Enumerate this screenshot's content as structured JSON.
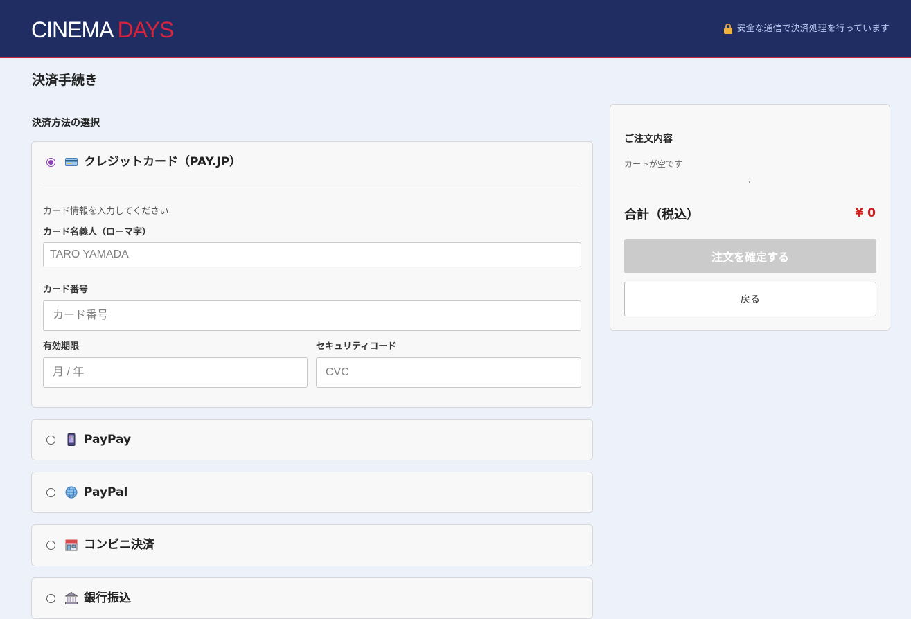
{
  "header": {
    "logo_main": "CINEMA",
    "logo_accent": "DAYS",
    "secure_text": "安全な通信で決済処理を行っています",
    "secure_icon": "lock-icon"
  },
  "page": {
    "title": "決済手続き",
    "section_label": "決済方法の選択"
  },
  "payment_methods": [
    {
      "label": "クレジットカード（PAY.JP）",
      "icon": "credit-card-icon",
      "selected": true
    },
    {
      "label": "PayPay",
      "icon": "phone-icon",
      "selected": false
    },
    {
      "label": "PayPal",
      "icon": "globe-icon",
      "selected": false
    },
    {
      "label": "コンビニ決済",
      "icon": "store-icon",
      "selected": false
    },
    {
      "label": "銀行振込",
      "icon": "bank-icon",
      "selected": false
    }
  ],
  "card_form": {
    "note": "カード情報を入力してください",
    "name_label": "カード名義人（ローマ字）",
    "name_placeholder": "TARO YAMADA",
    "number_label": "カード番号",
    "number_placeholder": "カード番号",
    "expiry_label": "有効期限",
    "expiry_placeholder": "月 / 年",
    "cvc_label": "セキュリティコード",
    "cvc_placeholder": "CVC"
  },
  "summary": {
    "title": "ご注文内容",
    "empty_text": "カートが空です",
    "total_label": "合計（税込）",
    "total_value": "¥ 0",
    "confirm_label": "注文を確定する",
    "back_label": "戻る"
  },
  "colors": {
    "header_bg": "#1f2d63",
    "accent_red": "#d6243e",
    "radio_selected": "#8e3cb3",
    "price_red": "#d0211f"
  }
}
